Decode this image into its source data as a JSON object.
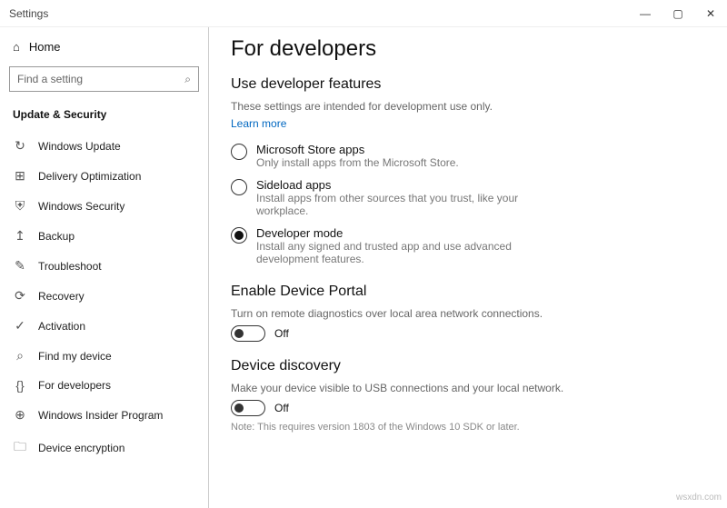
{
  "window": {
    "title": "Settings"
  },
  "sidebar": {
    "home": "Home",
    "search_placeholder": "Find a setting",
    "section": "Update & Security",
    "items": [
      {
        "icon": "↻",
        "label": "Windows Update"
      },
      {
        "icon": "⊞",
        "label": "Delivery Optimization"
      },
      {
        "icon": "⛨",
        "label": "Windows Security"
      },
      {
        "icon": "↥",
        "label": "Backup"
      },
      {
        "icon": "✎",
        "label": "Troubleshoot"
      },
      {
        "icon": "⟳",
        "label": "Recovery"
      },
      {
        "icon": "✓",
        "label": "Activation"
      },
      {
        "icon": "⌕",
        "label": "Find my device"
      },
      {
        "icon": "{}",
        "label": "For developers"
      },
      {
        "icon": "⊕",
        "label": "Windows Insider Program"
      },
      {
        "icon": "🗀",
        "label": "Device encryption"
      }
    ]
  },
  "main": {
    "title": "For developers",
    "dev_features": {
      "heading": "Use developer features",
      "desc": "These settings are intended for development use only.",
      "learn_more": "Learn more",
      "options": [
        {
          "label": "Microsoft Store apps",
          "sub": "Only install apps from the Microsoft Store.",
          "checked": false
        },
        {
          "label": "Sideload apps",
          "sub": "Install apps from other sources that you trust, like your workplace.",
          "checked": false
        },
        {
          "label": "Developer mode",
          "sub": "Install any signed and trusted app and use advanced development features.",
          "checked": true
        }
      ]
    },
    "device_portal": {
      "heading": "Enable Device Portal",
      "desc": "Turn on remote diagnostics over local area network connections.",
      "toggle": "Off"
    },
    "device_discovery": {
      "heading": "Device discovery",
      "desc": "Make your device visible to USB connections and your local network.",
      "toggle": "Off",
      "note": "Note: This requires version 1803 of the Windows 10 SDK or later."
    }
  },
  "watermark": "wsxdn.com"
}
